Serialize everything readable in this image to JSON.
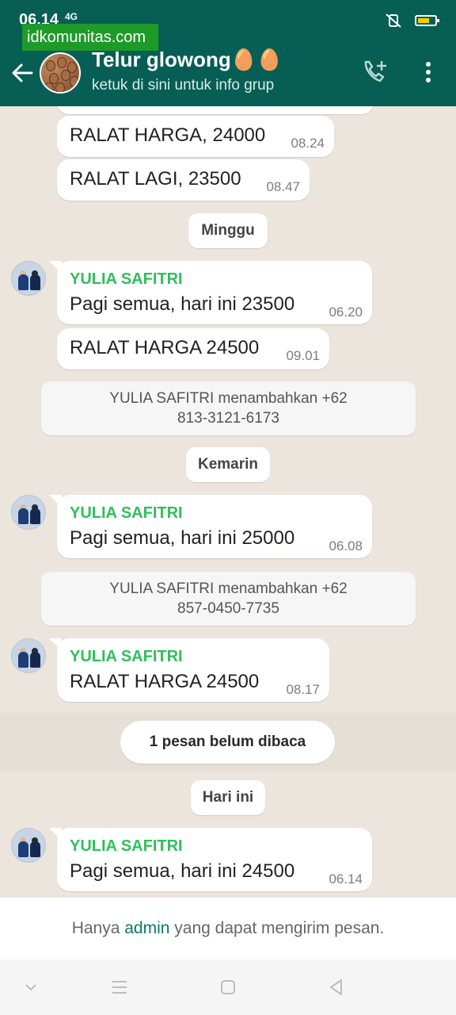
{
  "status_bar": {
    "time": "06.14",
    "network": "4G"
  },
  "watermark": "idkomunitas.com",
  "header": {
    "title": "Telur glowong🥚🥚",
    "subtitle": "ketuk di sini untuk info grup"
  },
  "messages": [
    {
      "text": "RALAT HARGA, 24000",
      "time": "08.24"
    },
    {
      "text": "RALAT LAGI, 23500",
      "time": "08.47"
    }
  ],
  "date_minggu": "Minggu",
  "msg_minggu_1": {
    "sender": "YULIA SAFITRI",
    "text": "Pagi semua, hari ini 23500",
    "time": "06.20"
  },
  "msg_minggu_2": {
    "text": "RALAT HARGA 24500",
    "time": "09.01"
  },
  "sys_1": {
    "line1": "YULIA SAFITRI menambahkan +62",
    "line2": "813-3121-6173"
  },
  "date_kemarin": "Kemarin",
  "msg_kemarin_1": {
    "sender": "YULIA SAFITRI",
    "text": "Pagi semua, hari ini 25000",
    "time": "06.08"
  },
  "sys_2": {
    "line1": "YULIA SAFITRI menambahkan +62",
    "line2": "857-0450-7735"
  },
  "msg_kemarin_2": {
    "sender": "YULIA SAFITRI",
    "text": "RALAT HARGA 24500",
    "time": "08.17"
  },
  "unread_label": "1 pesan belum dibaca",
  "date_hari_ini": "Hari ini",
  "msg_today": {
    "sender": "YULIA SAFITRI",
    "text": "Pagi semua, hari ini 24500",
    "time": "06.14"
  },
  "footer": {
    "prefix": "Hanya",
    "link": "admin",
    "suffix": "yang dapat mengirim pesan."
  },
  "colors": {
    "header": "#075e54",
    "sender": "#2fbf5b",
    "background": "#ece5dd",
    "link": "#0a7a65"
  }
}
